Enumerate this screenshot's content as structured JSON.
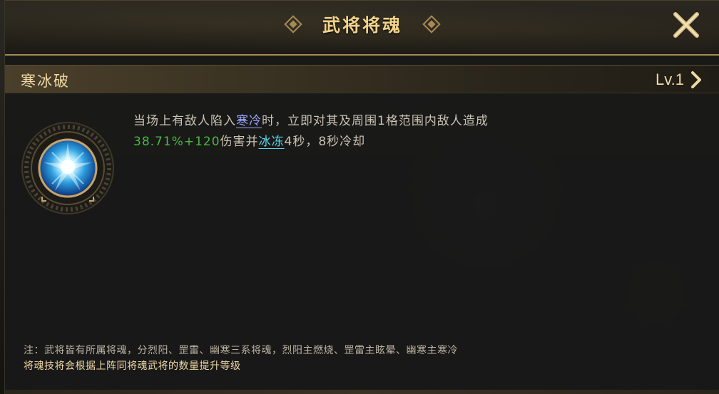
{
  "window": {
    "title": "武将将魂",
    "close_label": "✕"
  },
  "skill": {
    "name": "寒冰破",
    "level": "Lv.1",
    "icon": "ice-burst-skill-icon",
    "description": {
      "part1": "当场上有敌人陷入",
      "keyword_chill": "寒冷",
      "part2": "时，立即对其及周围1格范围内敌人造成",
      "damage": "38.71%+120",
      "part3": "伤害并",
      "keyword_freeze": "冰冻",
      "part4": "4秒，8秒冷却"
    }
  },
  "notes": {
    "line1": "注：武将皆有所属将魂，分烈阳、罡雷、幽寒三系将魂，烈阳主燃烧、罡雷主眩晕、幽寒主寒冷",
    "line2": "将魂技将会根据上阵同将魂武将的数量提升等级"
  },
  "colors": {
    "gold": "#f2d38a",
    "keyword_chill": "#9ea7ff",
    "keyword_freeze": "#57d6e8",
    "damage_green": "#49b93f"
  }
}
